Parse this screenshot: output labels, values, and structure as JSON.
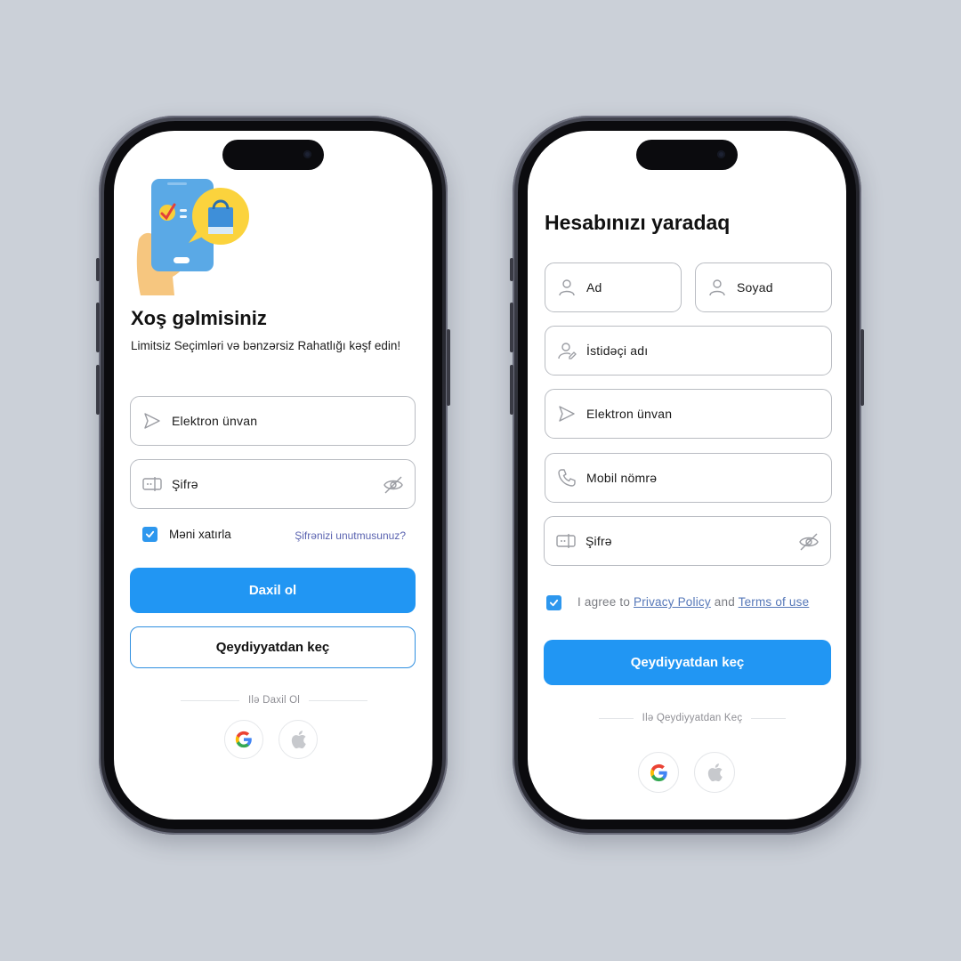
{
  "login": {
    "title": "Xoş gəlmisiniz",
    "subtitle": "Limitsiz Seçimləri və bənzərsiz Rahatlığı kəşf edin!",
    "email_label": "Elektron ünvan",
    "password_label": "Şifrə",
    "remember_label": "Məni xatırla",
    "remember_checked": true,
    "forgot_label": "Şifrənizi unutmusunuz?",
    "login_button": "Daxil ol",
    "register_button": "Qeydiyyatdan keç",
    "divider_text": "Ilə Daxil Ol",
    "social": [
      "google-icon",
      "apple-icon"
    ]
  },
  "register": {
    "title": "Hesabınızı yaradaq",
    "first_name_label": "Ad",
    "last_name_label": "Soyad",
    "username_label": "İstidəçi adı",
    "email_label": "Elektron ünvan",
    "phone_label": "Mobil nömrə",
    "password_label": "Şifrə",
    "agree_checked": true,
    "agree_prefix": "I agree to",
    "privacy_link": "Privacy Policy",
    "agree_and": "and",
    "terms_link": "Terms of use",
    "register_button": "Qeydiyyatdan keç",
    "divider_text": "Ilə Qeydiyyatdan Keç",
    "social": [
      "google-icon",
      "apple-icon"
    ]
  },
  "colors": {
    "background": "#cbd0d8",
    "primary": "#2196f3",
    "link": "#5577b8",
    "field_border": "#b9bcc2"
  }
}
